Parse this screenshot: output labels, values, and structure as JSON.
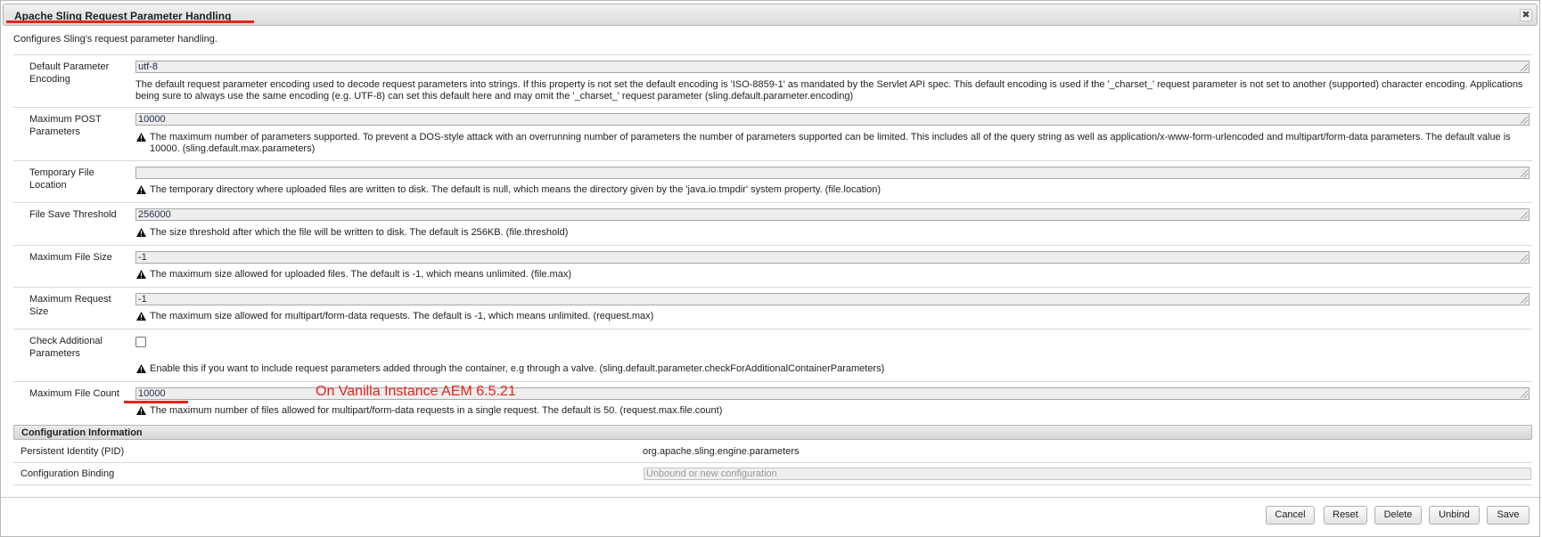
{
  "dialog": {
    "title": "Apache Sling Request Parameter Handling",
    "close_icon": "close-icon",
    "intro": "Configures Sling's request parameter handling."
  },
  "fields": [
    {
      "label": "Default Parameter Encoding",
      "value": "utf-8",
      "description": "The default request parameter encoding used to decode request parameters into strings. If this property is not set the default encoding is 'ISO-8859-1' as mandated by the Servlet API spec. This default encoding is used if the '_charset_' request parameter is not set to another (supported) character encoding. Applications being sure to always use the same encoding (e.g. UTF-8) can set this default here and may omit the '_charset_' request parameter (sling.default.parameter.encoding)"
    },
    {
      "label": "Maximum POST Parameters",
      "value": "10000",
      "description": "The maximum number of parameters supported. To prevent a DOS-style attack with an overrunning number of parameters the number of parameters supported can be limited. This includes all of the query string as well as application/x-www-form-urlencoded and multipart/form-data parameters. The default value is 10000. (sling.default.max.parameters)"
    },
    {
      "label": "Temporary File Location",
      "value": "",
      "description": "The temporary directory where uploaded files are written to disk. The default is null, which means the directory given by the 'java.io.tmpdir' system property. (file.location)"
    },
    {
      "label": "File Save Threshold",
      "value": "256000",
      "description": "The size threshold after which the file will be written to disk. The default is 256KB. (file.threshold)"
    },
    {
      "label": "Maximum File Size",
      "value": "-1",
      "description": "The maximum size allowed for uploaded files. The default is -1, which means unlimited. (file.max)"
    },
    {
      "label": "Maximum Request Size",
      "value": "-1",
      "description": "The maximum size allowed for multipart/form-data requests. The default is -1, which means unlimited. (request.max)"
    },
    {
      "label": "Check Additional Parameters",
      "checked": false,
      "description": "Enable this if you want to include request parameters added through the container, e.g through a valve. (sling.default.parameter.checkForAdditionalContainerParameters)"
    },
    {
      "label": "Maximum File Count",
      "value": "10000",
      "description": "The maximum number of files allowed for multipart/form-data requests in a single request. The default is 50. (request.max.file.count)"
    }
  ],
  "annotation": {
    "note": "On Vanilla Instance AEM 6.5.21",
    "color": "#e8231b"
  },
  "config_info": {
    "header": "Configuration Information",
    "pid_label": "Persistent Identity (PID)",
    "pid_value": "org.apache.sling.engine.parameters",
    "binding_label": "Configuration Binding",
    "binding_value": "Unbound or new configuration"
  },
  "buttons": {
    "cancel": "Cancel",
    "reset": "Reset",
    "delete": "Delete",
    "unbind": "Unbind",
    "save": "Save"
  },
  "icons": {
    "warning": "warning-icon"
  }
}
